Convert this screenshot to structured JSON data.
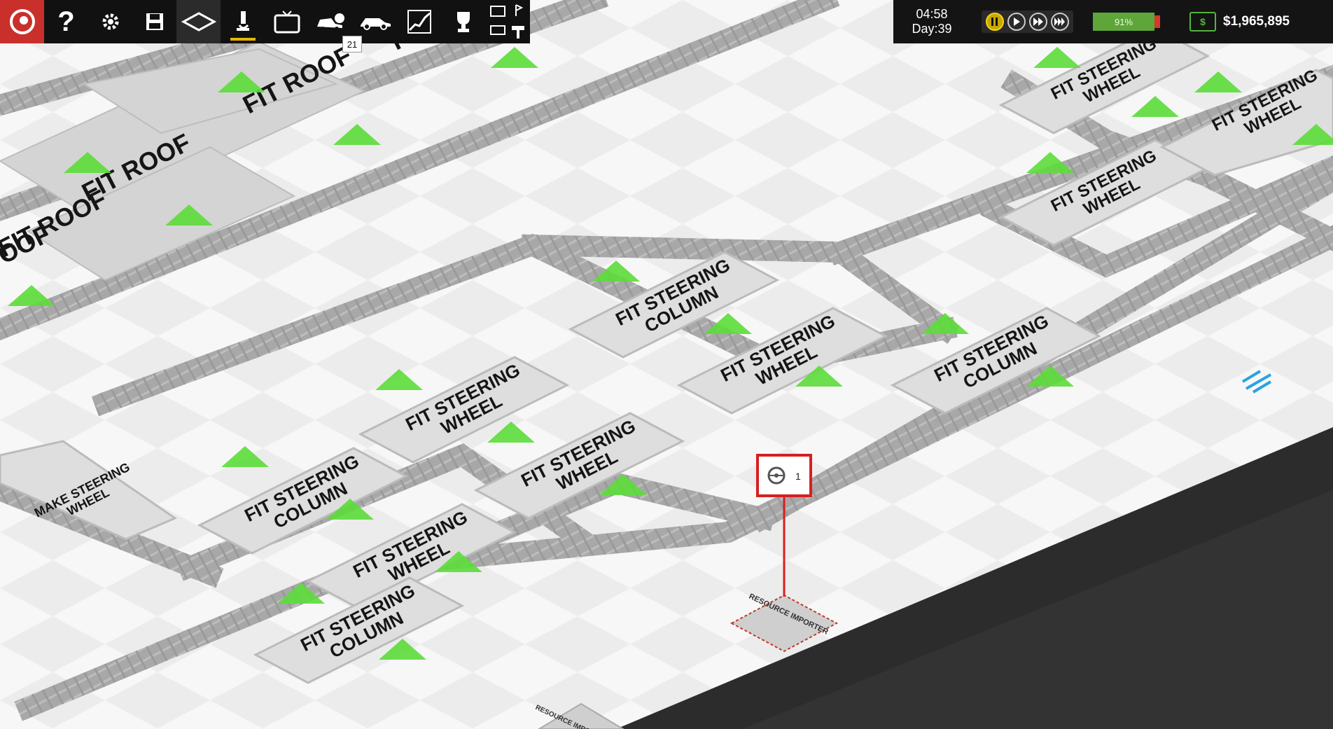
{
  "toolbar": {
    "items": [
      {
        "name": "logo-icon"
      },
      {
        "name": "help-icon",
        "label": "?"
      },
      {
        "name": "settings-icon"
      },
      {
        "name": "save-icon"
      },
      {
        "name": "build-mode-icon"
      },
      {
        "name": "research-icon"
      },
      {
        "name": "marketing-icon"
      },
      {
        "name": "car-sales-icon"
      },
      {
        "name": "car-design-icon"
      },
      {
        "name": "stats-icon"
      },
      {
        "name": "achievements-icon"
      },
      {
        "name": "display-icon"
      }
    ],
    "badge": "21"
  },
  "hud": {
    "time": "04:58",
    "day": "Day:39",
    "battery": "91%",
    "money": "$1,965,895"
  },
  "world": {
    "zone_labels": [
      {
        "text": "FIT STEERING COLUMN"
      },
      {
        "text": "FIT STEERING WHEEL"
      },
      {
        "text": "FIT STEERING COLUMN"
      },
      {
        "text": "FIT STEERING WHEEL"
      },
      {
        "text": "FIT STEERING WHEEL"
      },
      {
        "text": "FIT STEERING COLUMN"
      },
      {
        "text": "FIT STEERING WHEEL"
      },
      {
        "text": "FIT STEERING COLUMN"
      },
      {
        "text": "FIT STEERING WHEEL"
      },
      {
        "text": "FIT STEERING WHEEL"
      },
      {
        "text": "FIT STEERING WHEEL"
      },
      {
        "text": "MAKE STEERING WHEEL"
      },
      {
        "text": "FIT ROOF"
      },
      {
        "text": "FIT ROOF"
      },
      {
        "text": "FIT ROOF"
      },
      {
        "text": "FIT"
      },
      {
        "text": "OOF"
      }
    ],
    "importer_label": "RESOURCE IMPORTER",
    "importer2_label": "RESOURCE IMPORTER",
    "callout_count": "1",
    "colors": {
      "accent": "#c9302c",
      "conveyor": "#a9a9a9",
      "arrow": "#5cdc3a",
      "money": "#53b53a"
    }
  }
}
